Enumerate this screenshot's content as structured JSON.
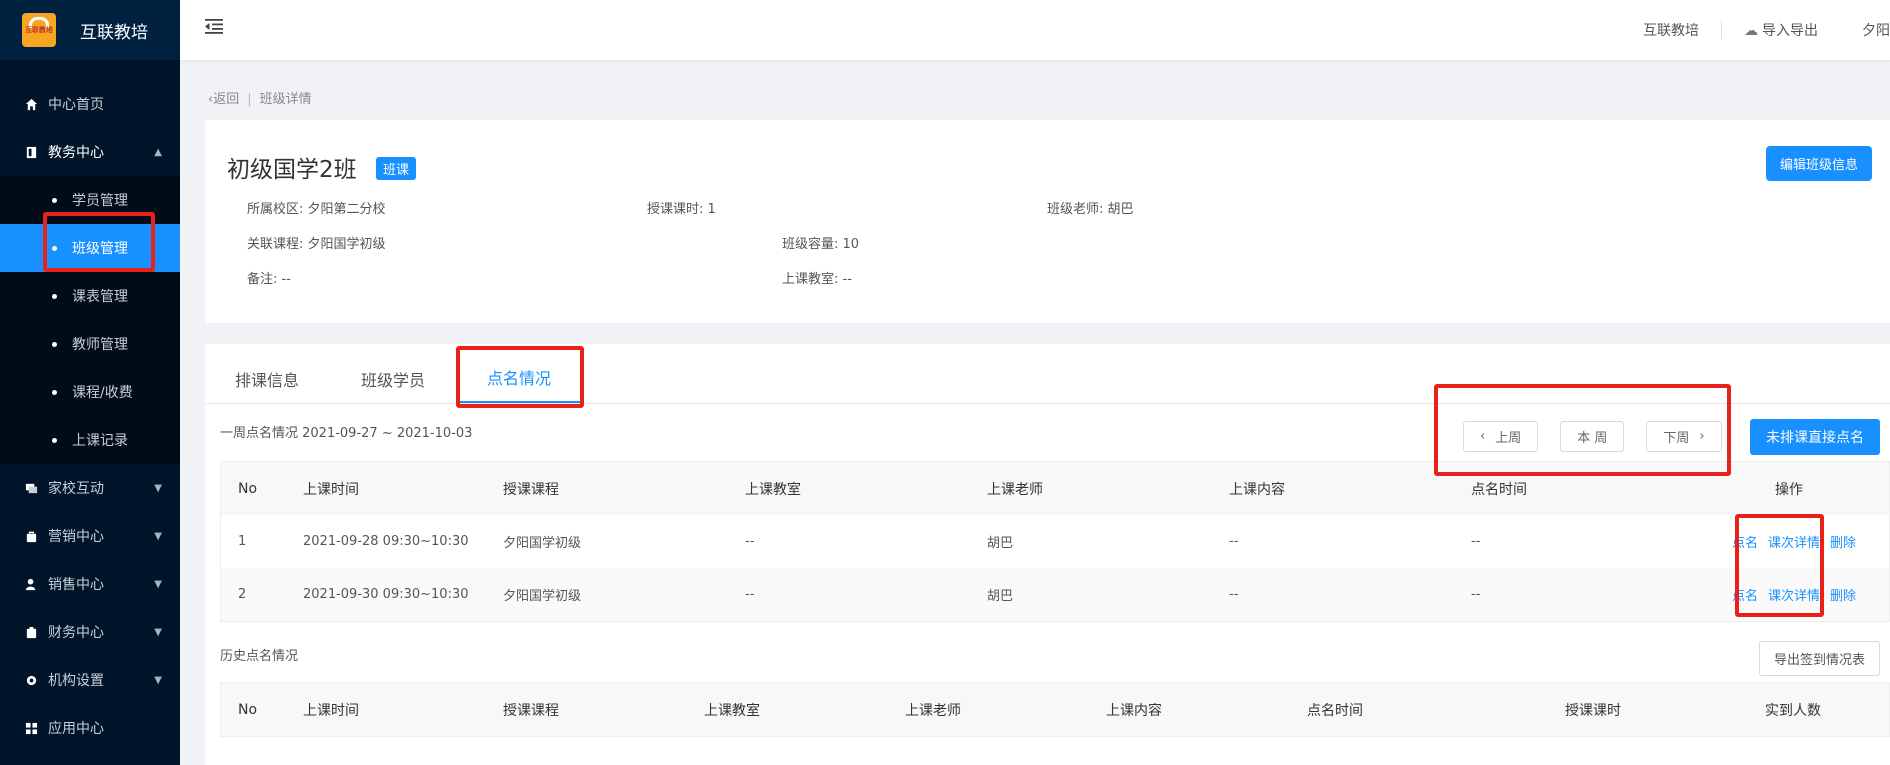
{
  "app": {
    "title": "互联教培",
    "logo_text": "互联教培"
  },
  "sidebar": {
    "items": [
      {
        "label": "中心首页",
        "icon": "home-icon"
      },
      {
        "label": "教务中心",
        "icon": "book-icon",
        "expanded": true
      },
      {
        "label": "家校互动",
        "icon": "chat-icon"
      },
      {
        "label": "营销中心",
        "icon": "bag-icon"
      },
      {
        "label": "销售中心",
        "icon": "user-icon"
      },
      {
        "label": "财务中心",
        "icon": "wallet-icon"
      },
      {
        "label": "机构设置",
        "icon": "gear-icon"
      },
      {
        "label": "应用中心",
        "icon": "grid-icon"
      }
    ],
    "subitems": [
      "学员管理",
      "班级管理",
      "课表管理",
      "教师管理",
      "课程/收费",
      "上课记录"
    ],
    "active_subitem": "班级管理"
  },
  "header": {
    "links": [
      "互联教培",
      "导入导出",
      "夕阳"
    ]
  },
  "breadcrumb": {
    "back": "返回",
    "current": "班级详情"
  },
  "class_info": {
    "name": "初级国学2班",
    "tag": "班课",
    "edit_button": "编辑班级信息",
    "fields": {
      "campus": "所属校区: 夕阳第二分校",
      "hours": "授课课时: 1",
      "teacher": "班级老师: 胡巴",
      "course": "关联课程: 夕阳国学初级",
      "capacity": "班级容量: 10",
      "note": "备注: --",
      "classroom": "上课教室: --"
    }
  },
  "tabs": [
    "排课信息",
    "班级学员",
    "点名情况"
  ],
  "active_tab": "点名情况",
  "week": {
    "range": "一周点名情况 2021-09-27 ~ 2021-10-03",
    "prev": "上周",
    "current": "本 周",
    "next": "下周",
    "direct_button": "未排课直接点名"
  },
  "week_table": {
    "headers": [
      "No",
      "上课时间",
      "授课课程",
      "上课教室",
      "上课老师",
      "上课内容",
      "点名时间",
      "操作"
    ],
    "rows": [
      {
        "no": "1",
        "time": "2021-09-28 09:30~10:30",
        "course": "夕阳国学初级",
        "room": "--",
        "teacher": "胡巴",
        "content": "--",
        "rollcall": "--"
      },
      {
        "no": "2",
        "time": "2021-09-30 09:30~10:30",
        "course": "夕阳国学初级",
        "room": "--",
        "teacher": "胡巴",
        "content": "--",
        "rollcall": "--"
      }
    ],
    "actions": [
      "点名",
      "课次详情",
      "删除"
    ]
  },
  "history": {
    "title": "历史点名情况",
    "export_button": "导出签到情况表",
    "headers": [
      "No",
      "上课时间",
      "授课课程",
      "上课教室",
      "上课老师",
      "上课内容",
      "点名时间",
      "授课课时",
      "实到人数"
    ]
  },
  "colors": {
    "accent": "#1890ff",
    "sidebar_bg": "#001529",
    "highlight": "#e8211b"
  }
}
